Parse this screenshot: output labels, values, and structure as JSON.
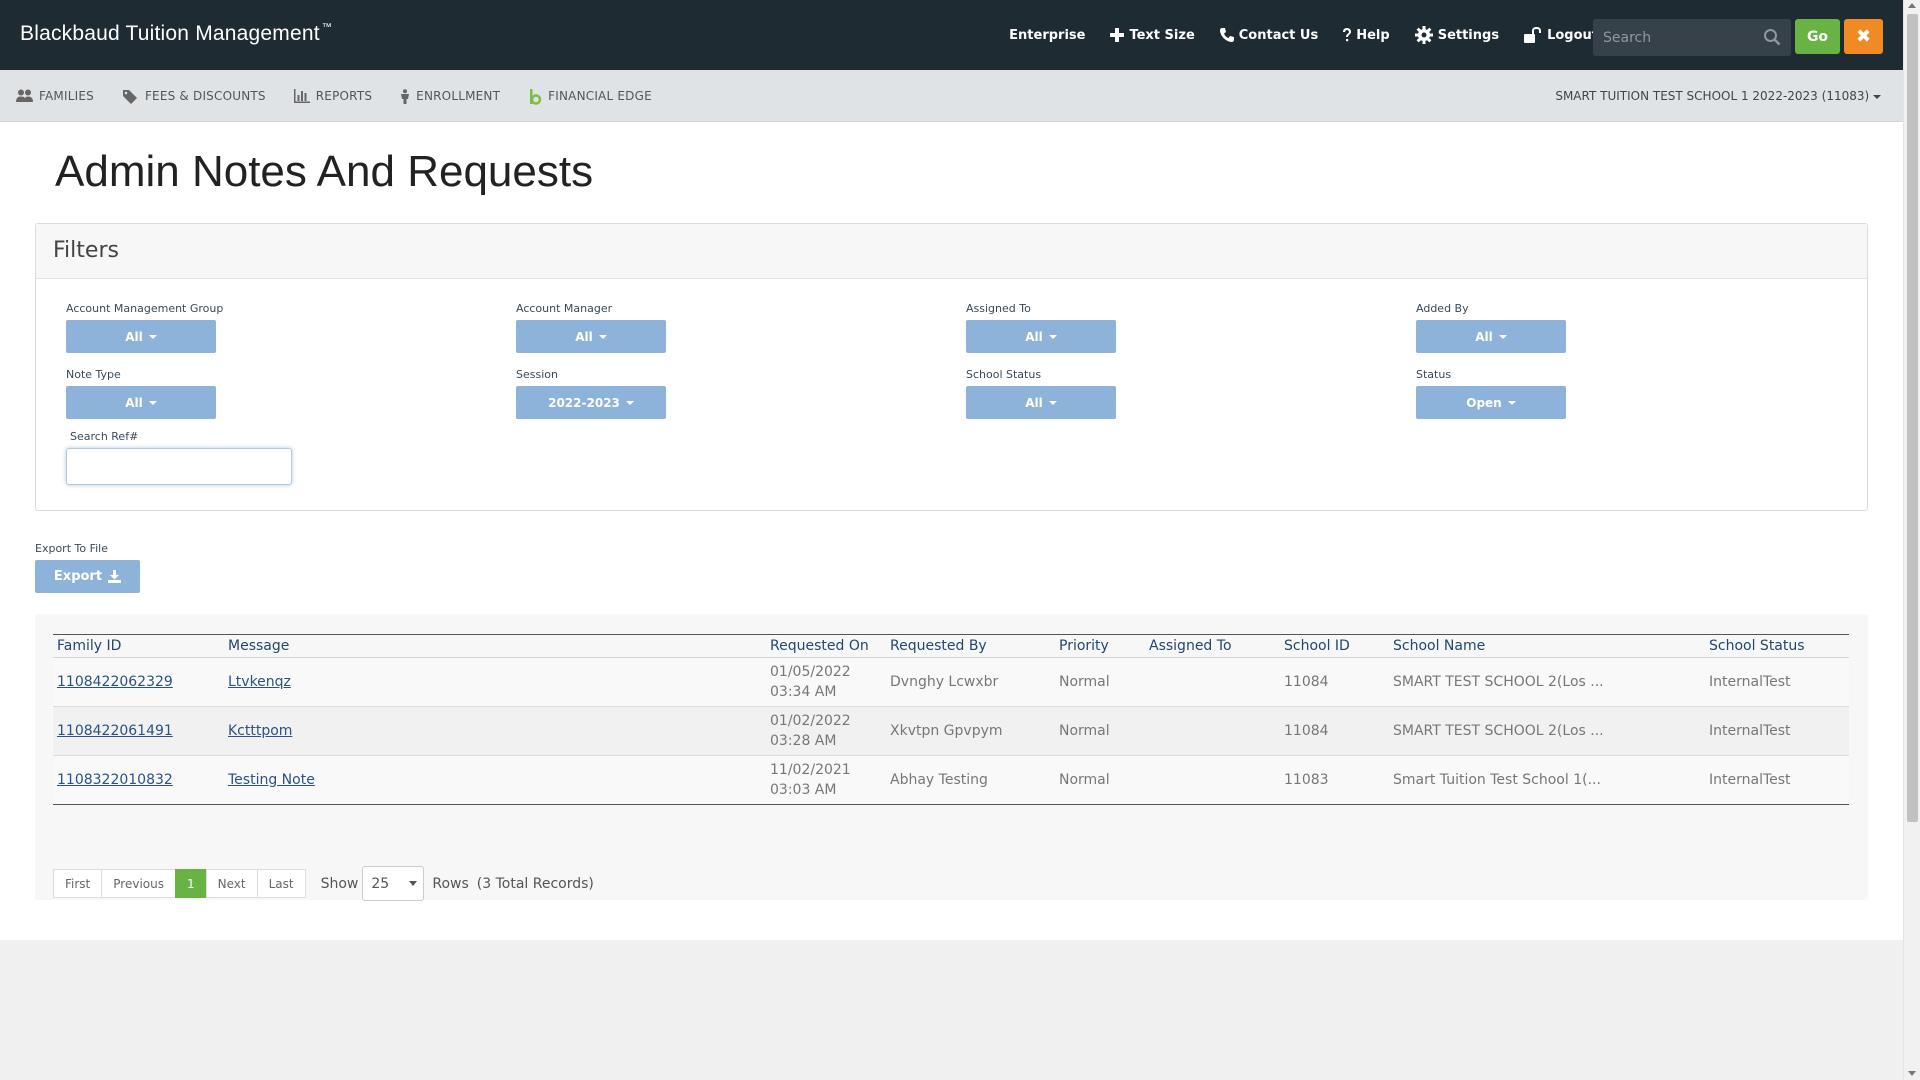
{
  "header": {
    "brand": "Blackbaud Tuition Management",
    "trademark": "™",
    "links": [
      {
        "label": "Enterprise",
        "icon": ""
      },
      {
        "label": "Text Size",
        "icon": "plus-icon"
      },
      {
        "label": "Contact Us",
        "icon": "phone-icon"
      },
      {
        "label": "Help",
        "icon": "question-icon"
      },
      {
        "label": "Settings",
        "icon": "gear-icon"
      },
      {
        "label": "Logout",
        "icon": "unlock-icon"
      }
    ],
    "search_placeholder": "Search",
    "go_label": "Go",
    "close_label": "✖"
  },
  "subnav": {
    "items": [
      {
        "label": "FAMILIES",
        "icon": "users-icon"
      },
      {
        "label": "FEES & DISCOUNTS",
        "icon": "tags-icon"
      },
      {
        "label": "REPORTS",
        "icon": "bar-chart-icon"
      },
      {
        "label": "ENROLLMENT",
        "icon": "person-icon"
      },
      {
        "label": "FINANCIAL EDGE",
        "icon": "financial-edge-logo-icon"
      }
    ],
    "school_selector": "SMART TUITION TEST SCHOOL 1 2022-2023 (11083)"
  },
  "page": {
    "title": "Admin Notes And Requests"
  },
  "filters": {
    "heading": "Filters",
    "account_management_group": {
      "label": "Account Management Group",
      "value": "All"
    },
    "account_manager": {
      "label": "Account Manager",
      "value": "All"
    },
    "assigned_to": {
      "label": "Assigned To",
      "value": "All"
    },
    "added_by": {
      "label": "Added By",
      "value": "All"
    },
    "note_type": {
      "label": "Note Type",
      "value": "All"
    },
    "session": {
      "label": "Session",
      "value": "2022-2023"
    },
    "school_status": {
      "label": "School Status",
      "value": "All"
    },
    "status": {
      "label": "Status",
      "value": "Open"
    },
    "search_ref": {
      "label": "Search Ref#",
      "value": ""
    }
  },
  "export": {
    "label": "Export To File",
    "button": "Export"
  },
  "table": {
    "columns": [
      "Family ID",
      "Message",
      "Requested On",
      "Requested By",
      "Priority",
      "Assigned To",
      "School ID",
      "School Name",
      "School Status"
    ],
    "rows": [
      {
        "family_id": "1108422062329",
        "message": "Ltvkenqz",
        "date": "01/05/2022",
        "time": "03:34 AM",
        "requested_by": "Dvnghy Lcwxbr",
        "priority": "Normal",
        "assigned_to": "",
        "school_id": "11084",
        "school_name": "SMART TEST SCHOOL 2(Los ...",
        "school_status": "InternalTest"
      },
      {
        "family_id": "1108422061491",
        "message": "Kctttpom",
        "date": "01/02/2022",
        "time": "03:28 AM",
        "requested_by": "Xkvtpn Gpvpym",
        "priority": "Normal",
        "assigned_to": "",
        "school_id": "11084",
        "school_name": "SMART TEST SCHOOL 2(Los ...",
        "school_status": "InternalTest"
      },
      {
        "family_id": "1108322010832",
        "message": "Testing Note",
        "date": "11/02/2021",
        "time": "03:03 AM",
        "requested_by": "Abhay Testing",
        "priority": "Normal",
        "assigned_to": "",
        "school_id": "11083",
        "school_name": "Smart Tuition Test School 1(...",
        "school_status": "InternalTest"
      }
    ]
  },
  "pagination": {
    "first": "First",
    "previous": "Previous",
    "current": "1",
    "next": "Next",
    "last": "Last",
    "show_label": "Show",
    "rows_per_page": "25",
    "rows_label": "Rows",
    "total_records": "(3 Total Records)"
  },
  "colors": {
    "header_bg": "#1f2b33",
    "go_green": "#68b344",
    "close_orange": "#f08a24",
    "filter_button": "#8eb3db",
    "link_blue": "#2a5285"
  }
}
